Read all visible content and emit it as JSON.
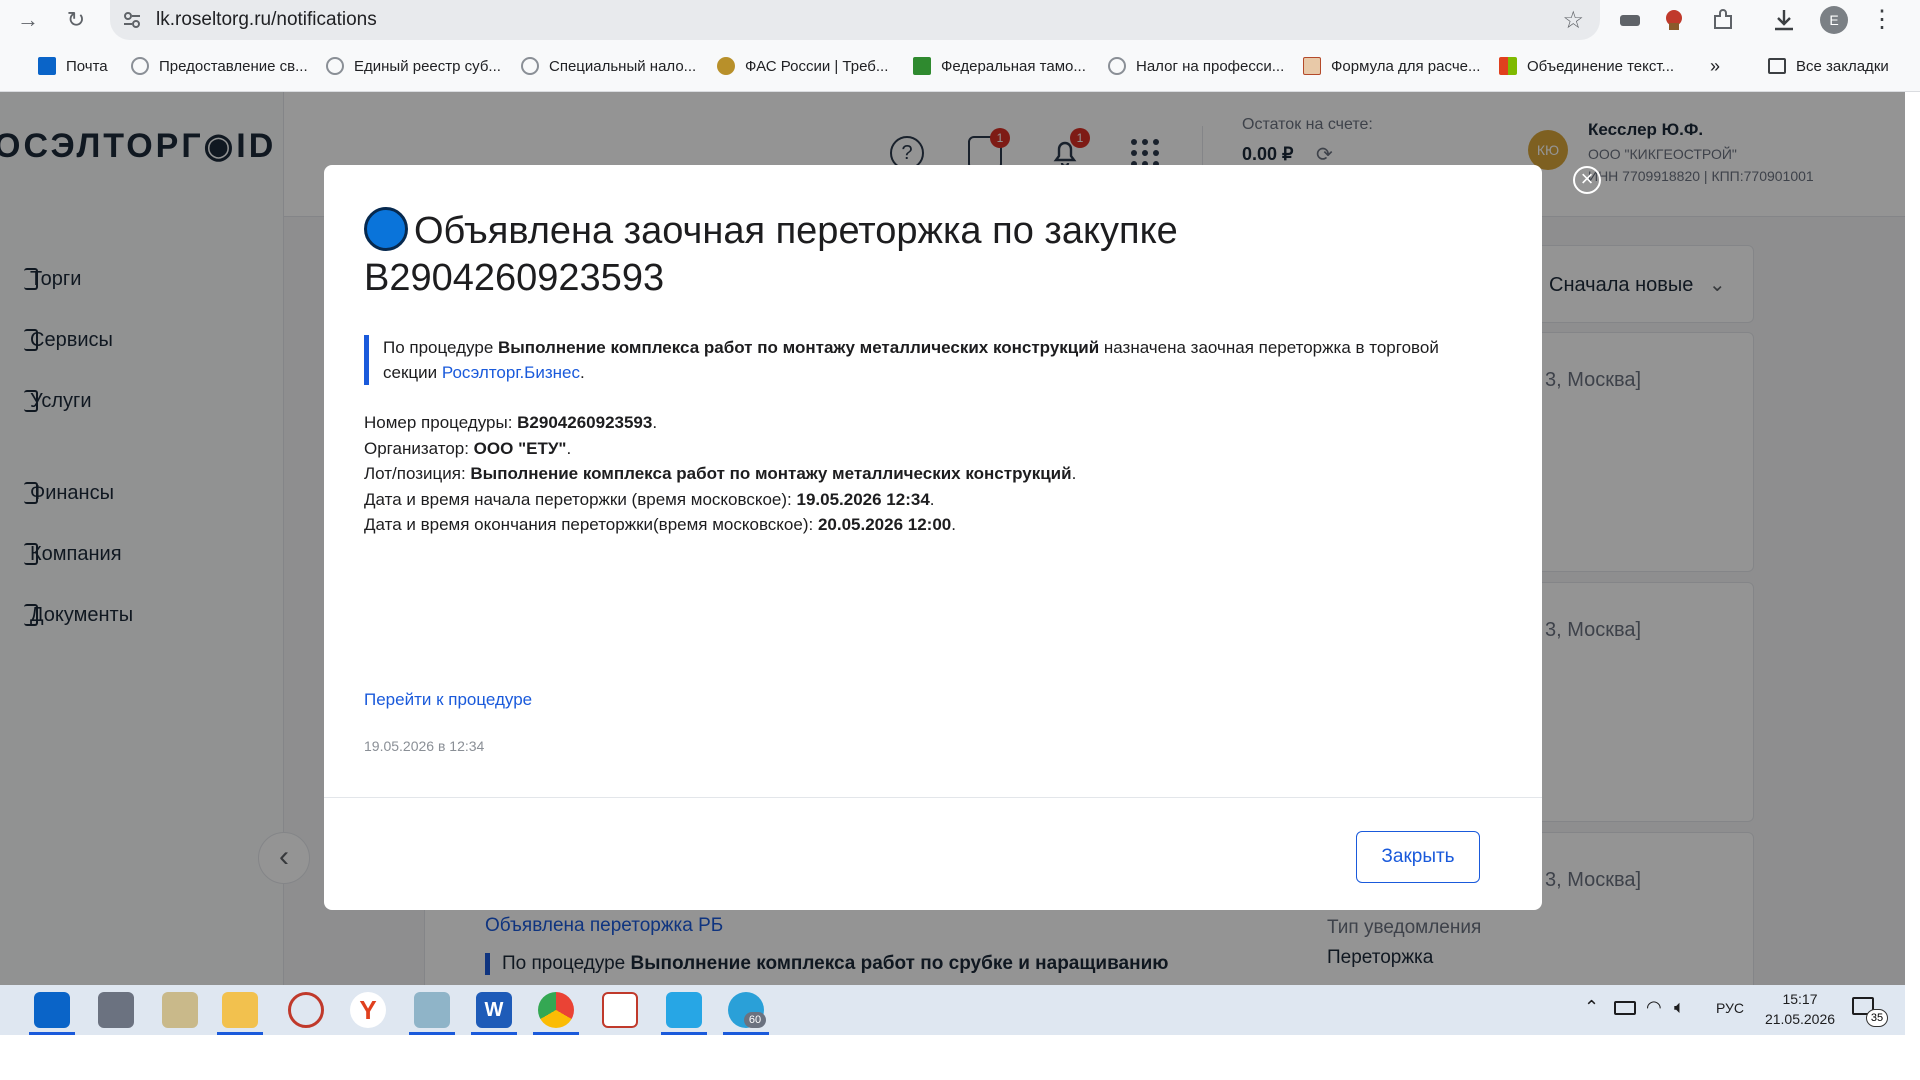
{
  "browser": {
    "url": "lk.roseltorg.ru/notifications",
    "profile_initial": "E",
    "bookmarks": [
      {
        "label": "Почта",
        "color": "#0a64c8"
      },
      {
        "label": "Предоставление св...",
        "color": "#8a8f96"
      },
      {
        "label": "Единый реестр суб...",
        "color": "#8a8f96"
      },
      {
        "label": "Специальный нало...",
        "color": "#8a8f96"
      },
      {
        "label": "ФАС России | Треб...",
        "color": "#b8902a"
      },
      {
        "label": "Федеральная тамо...",
        "color": "#2f8a2f"
      },
      {
        "label": "Налог на професси...",
        "color": "#8a8f96"
      },
      {
        "label": "Формула для расче...",
        "color": "#b44a2a"
      },
      {
        "label": "Объединение текст...",
        "color": "#e0401e"
      }
    ],
    "more_bookmarks": "»",
    "all_bookmarks": "Все закладки"
  },
  "app": {
    "logo": "ОСЭЛТОРГ◉ID",
    "sidebar": [
      "Торги",
      "Сервисы",
      "Услуги",
      "Финансы",
      "Компания",
      "Документы"
    ],
    "header": {
      "calendar_badge": "1",
      "bell_badge": "1",
      "balance_label": "Остаток на счете:",
      "balance_value": "0.00 ₽",
      "avatar_initials": "КЮ",
      "user_name": "Кесслер Ю.Ф.",
      "company": "ООО \"КИКГЕОСТРОЙ\"",
      "inn_kpp": "ИНН 7709918820 | КПП:770901001"
    },
    "sort_label": "Сначала новые",
    "list_location_1": "3, Москва]",
    "list_location_2": "3, Москва]",
    "list_location_3": "3, Москва]",
    "bg_notification_title": "Объявлена переторжка РБ",
    "bg_notification_lead_prefix": "По процедуре ",
    "bg_notification_lead_bold": "Выполнение комплекса работ по срубке и наращиванию",
    "bg_type_label": "Тип уведомления",
    "bg_type_value": "Переторжка"
  },
  "modal": {
    "title": "Объявлена заочная переторжка по закупке B2904260923593",
    "lead_prefix": "По процедуре ",
    "lead_bold": "Выполнение комплекса работ по монтажу металлических конструкций",
    "lead_middle": " назначена заочная переторжка в торговой секции ",
    "lead_link": "Росэлторг.Бизнес",
    "lead_suffix": ".",
    "details": [
      {
        "label": "Номер процедуры: ",
        "value": "B2904260923593",
        "end": "."
      },
      {
        "label": "Организатор: ",
        "value": "ООО \"ЕТУ\"",
        "end": "."
      },
      {
        "label": "Лот/позиция: ",
        "value": "Выполнение комплекса работ по монтажу металлических конструкций",
        "end": "."
      },
      {
        "label": "Дата и время начала переторжки (время московское): ",
        "value": "19.05.2026 12:34",
        "end": "."
      },
      {
        "label": "Дата и время окончания переторжки(время московское): ",
        "value": "20.05.2026 12:00",
        "end": "."
      }
    ],
    "goto_link": "Перейти к процедуре",
    "timestamp": "19.05.2026 в 12:34",
    "close_button": "Закрыть"
  },
  "taskbar": {
    "telegram_badge": "60",
    "language": "РУС",
    "time": "15:17",
    "date": "21.05.2026",
    "notifications_count": "35"
  }
}
